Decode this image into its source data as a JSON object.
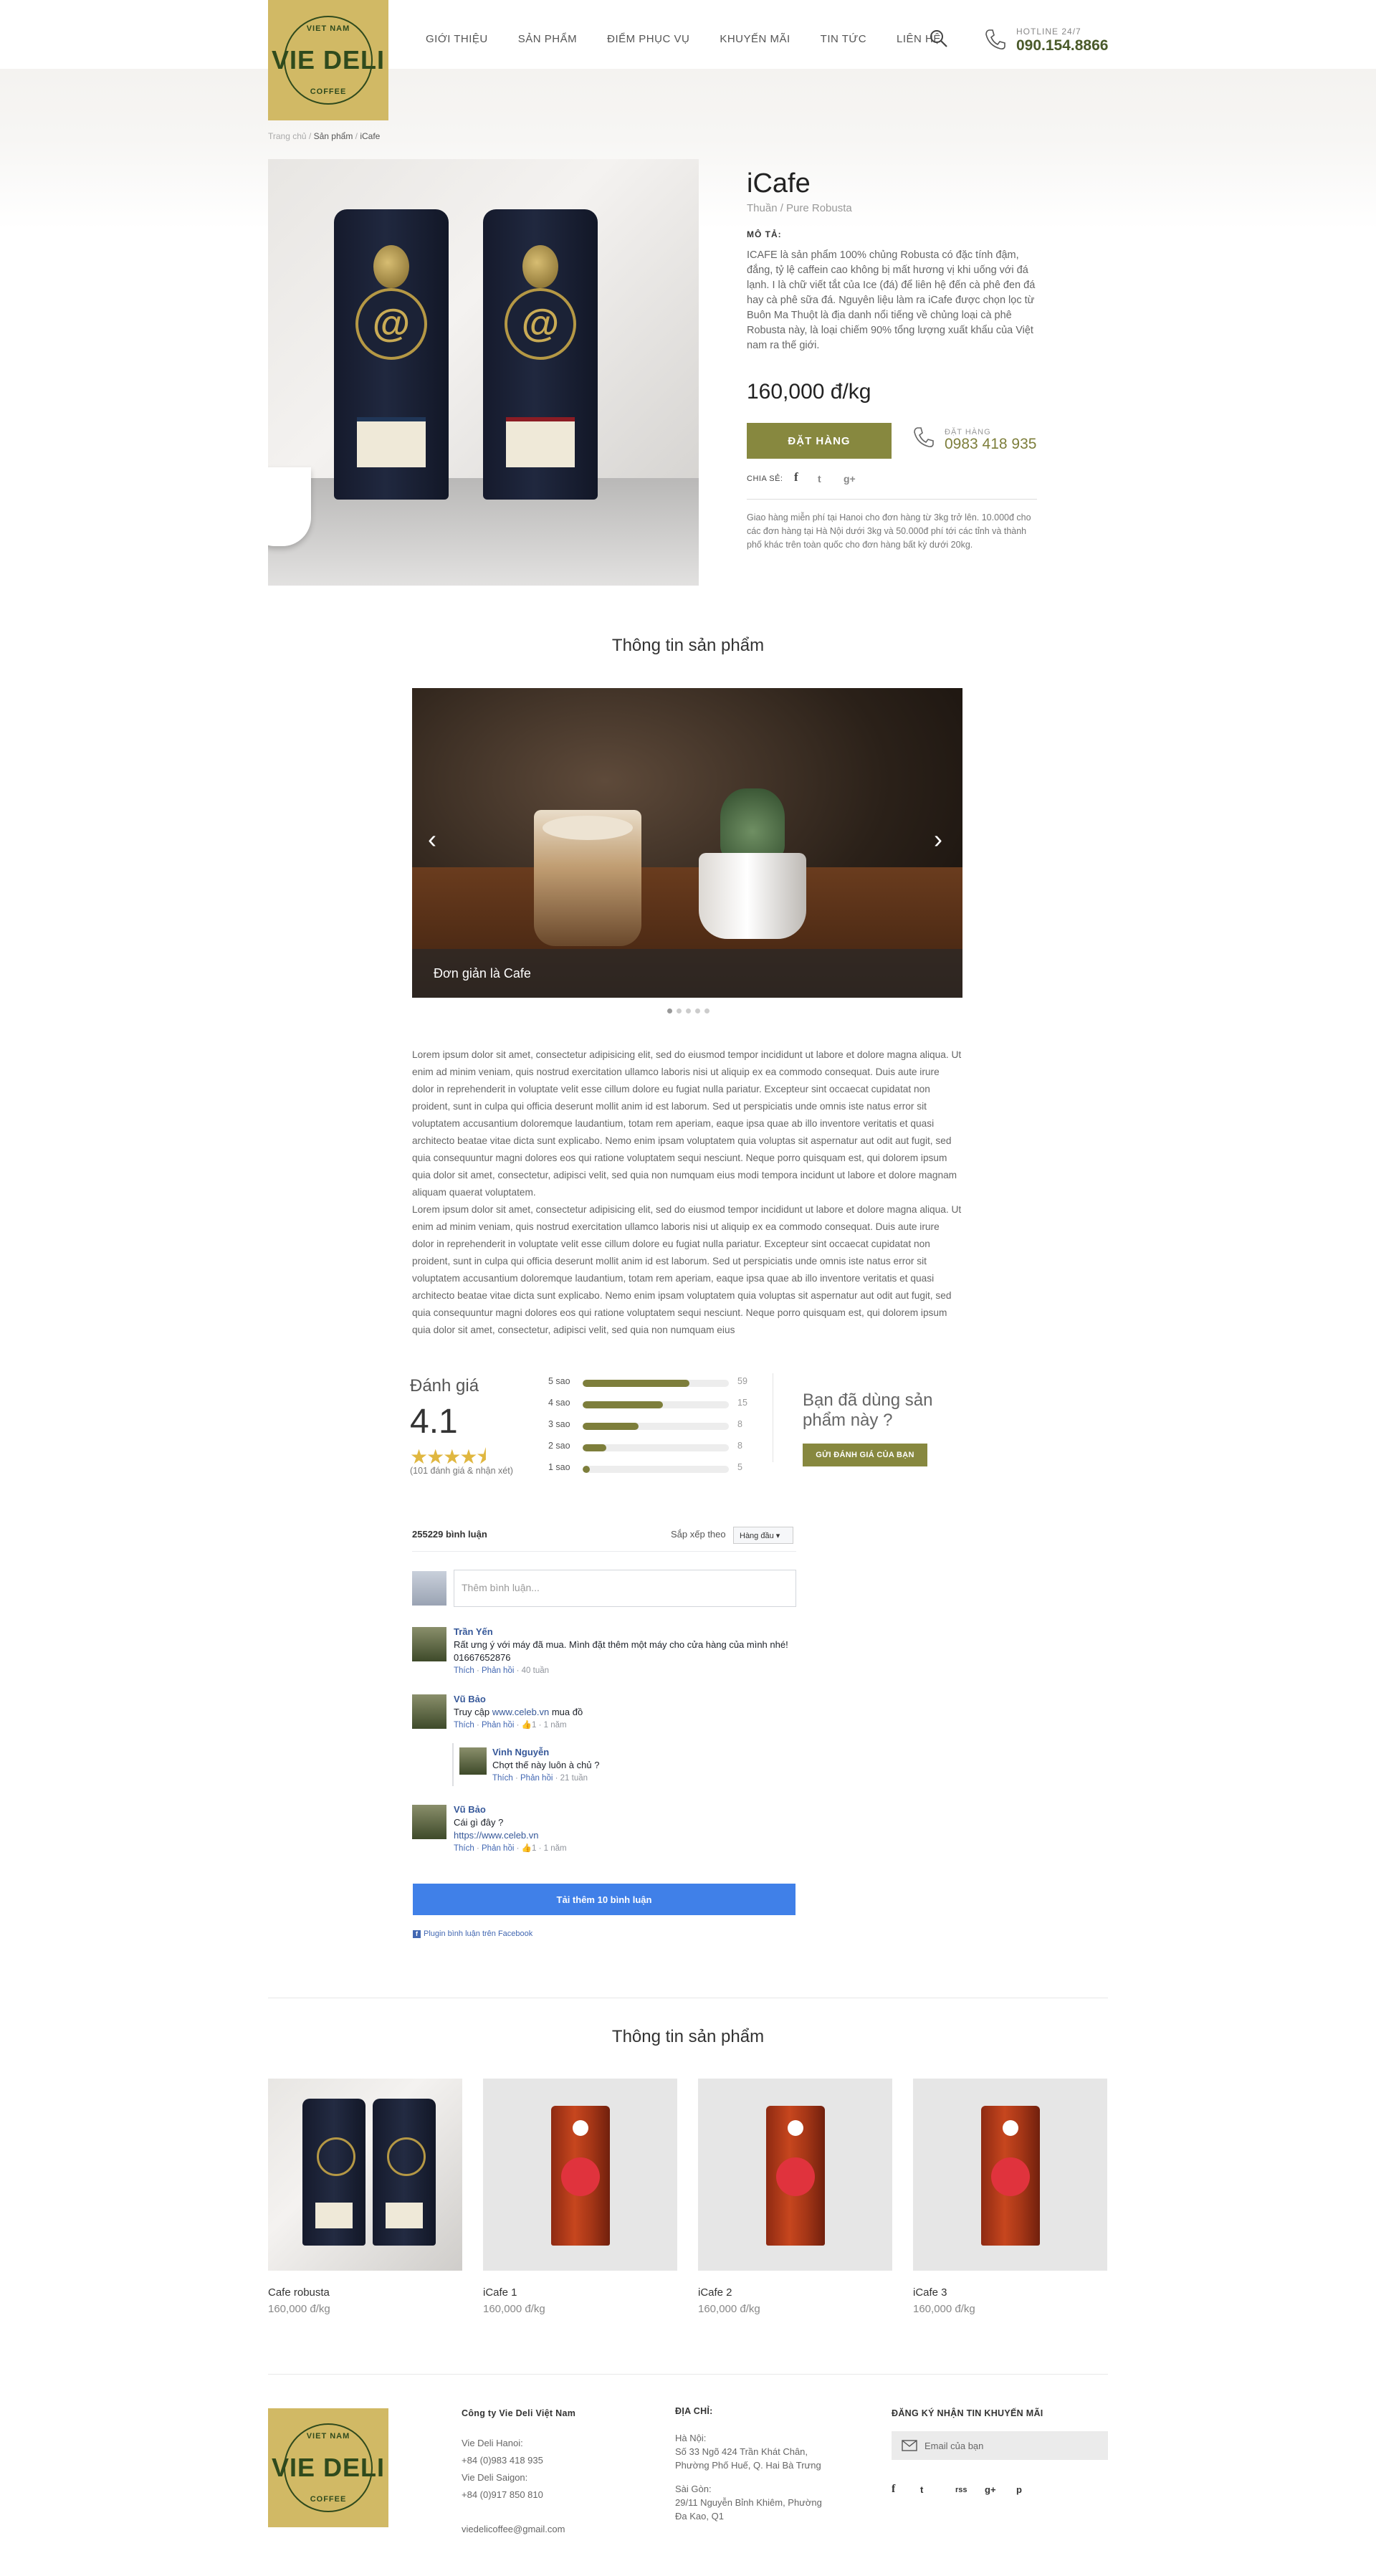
{
  "header": {
    "logo_top": "VIET NAM",
    "logo_main": "VIE DELI",
    "logo_bottom": "COFFEE",
    "nav": [
      "GIỚI THIỆU",
      "SẢN PHẨM",
      "ĐIỂM PHỤC VỤ",
      "KHUYẾN MÃI",
      "TIN TỨC",
      "LIÊN HỆ"
    ],
    "search_icon": "search-icon",
    "hotline_label": "HOTLINE 24/7",
    "hotline": "090.154.8866"
  },
  "breadcrumb": {
    "home": "Trang chủ",
    "sep1": " / ",
    "cat": "Sản phẩm",
    "sep2": " / ",
    "current": "iCafe"
  },
  "product": {
    "title": "iCafe",
    "subtitle": "Thuần / Pure Robusta",
    "desc_label": "MÔ TẢ:",
    "desc": "ICAFE là sản phẩm 100% chủng Robusta có đặc tính đậm, đắng, tỷ lệ caffein cao không bị mất hương vị khi uống với đá lạnh. I là chữ viết tắt của Ice (đá) để liên hệ đến cà phê đen đá hay cà phê sữa đá. Nguyên liệu làm ra iCafe được chọn lọc từ Buôn Ma Thuột là địa danh nổi tiếng về chủng loại cà phê Robusta này, là loại chiếm 90% tổng lượng xuất khẩu của Việt nam ra thế giới.",
    "price": "160,000 đ/kg",
    "order_button": "ĐẶT HÀNG",
    "order_label": "ĐẶT HÀNG",
    "order_phone": "0983 418 935",
    "share_label": "CHIA SẺ:",
    "share": [
      "f",
      "t",
      "g+"
    ],
    "shipping": "Giao hàng miễn phí tại Hanoi cho đơn hàng từ 3kg trở lên. 10.000đ cho các đơn hàng tại Hà Nội dưới 3kg và 50.000đ phí tới các tỉnh và thành phố khác trên toàn quốc cho đơn hàng bất kỳ dưới 20kg."
  },
  "info": {
    "title": "Thông tin sản phẩm",
    "slide_caption": "Đơn giản là Cafe",
    "slides": 5,
    "active_slide": 1,
    "para1": "Lorem ipsum dolor sit amet, consectetur adipisicing elit, sed do eiusmod tempor incididunt ut labore et dolore magna aliqua. Ut enim ad minim veniam, quis nostrud exercitation ullamco laboris nisi ut aliquip ex ea commodo consequat. Duis aute irure dolor in reprehenderit in voluptate velit esse cillum dolore eu fugiat nulla pariatur. Excepteur sint occaecat cupidatat non proident, sunt in culpa qui officia deserunt mollit anim id est laborum. Sed ut perspiciatis unde omnis iste natus error sit voluptatem accusantium doloremque laudantium, totam rem aperiam, eaque ipsa quae ab illo inventore veritatis et quasi architecto beatae vitae dicta sunt explicabo. Nemo enim ipsam voluptatem quia voluptas sit aspernatur aut odit aut fugit, sed quia consequuntur magni dolores eos qui ratione voluptatem sequi nesciunt. Neque porro quisquam est, qui dolorem ipsum quia dolor sit amet, consectetur, adipisci velit, sed quia non numquam eius modi tempora incidunt ut labore et dolore magnam aliquam quaerat voluptatem.",
    "para2": "Lorem ipsum dolor sit amet, consectetur adipisicing elit, sed do eiusmod tempor incididunt ut labore et dolore magna aliqua. Ut enim ad minim veniam, quis nostrud exercitation ullamco laboris nisi ut aliquip ex ea commodo consequat. Duis aute irure dolor in reprehenderit in voluptate velit esse cillum dolore eu fugiat nulla pariatur. Excepteur sint occaecat cupidatat non proident, sunt in culpa qui officia deserunt mollit anim id est laborum. Sed ut perspiciatis unde omnis iste natus error sit voluptatem accusantium doloremque laudantium, totam rem aperiam, eaque ipsa quae ab illo inventore veritatis et quasi architecto beatae vitae dicta sunt explicabo. Nemo enim ipsam voluptatem quia voluptas sit aspernatur aut odit aut fugit, sed quia consequuntur magni dolores eos qui ratione voluptatem sequi nesciunt. Neque porro quisquam est, qui dolorem ipsum quia dolor sit amet, consectetur, adipisci velit, sed quia non numquam eius"
  },
  "rating": {
    "label": "Đánh giá",
    "score": "4.1",
    "stars": 4.1,
    "count": "(101 đánh giá & nhận xét)",
    "bars": [
      {
        "label": "5 sao",
        "count": "59",
        "pct": 0.73
      },
      {
        "label": "4 sao",
        "count": "15",
        "pct": 0.55
      },
      {
        "label": "3 sao",
        "count": "8",
        "pct": 0.38
      },
      {
        "label": "2 sao",
        "count": "8",
        "pct": 0.16
      },
      {
        "label": "1 sao",
        "count": "5",
        "pct": 0.05
      }
    ],
    "question": "Bạn đã dùng sản phẩm này ?",
    "review_button": "GỬI ĐÁNH GIÁ CỦA BẠN"
  },
  "comments": {
    "count": "255229 bình luận",
    "sort_label": "Sắp xếp theo",
    "sort_value": "Hàng đầu ▾",
    "placeholder": "Thêm bình luận...",
    "items": [
      {
        "name": "Trần Yến",
        "text": "Rất ưng ý với máy đã mua. Mình đặt thêm một máy cho cửa hàng của mình nhé! 01667652876",
        "like": "Thích",
        "reply": "Phản hồi",
        "time": "40 tuần"
      },
      {
        "name": "Vũ Bảo",
        "text": "Truy cập",
        "link": "www.celeb.vn",
        "text2": "mua đồ",
        "like": "Thích",
        "reply": "Phản hồi",
        "likes": "1",
        "time": "1 năm"
      },
      {
        "name": "Vinh Nguyễn",
        "text": "Chợt thế này luôn à chủ ?",
        "like": "Thích",
        "reply": "Phản hồi",
        "time": "21 tuần"
      },
      {
        "name": "Vũ Bảo",
        "text": "Cái gì đây ?",
        "link": "https://www.celeb.vn",
        "like": "Thích",
        "reply": "Phản hồi",
        "likes": "1",
        "time": "1 năm"
      }
    ],
    "more_button": "Tải thêm 10 bình luận",
    "plugin": "Plugin bình luận trên Facebook"
  },
  "related": {
    "title": "Thông tin sản phẩm",
    "items": [
      {
        "name": "Cafe robusta",
        "price": "160,000 đ/kg"
      },
      {
        "name": "iCafe 1",
        "price": "160,000 đ/kg"
      },
      {
        "name": "iCafe 2",
        "price": "160,000 đ/kg"
      },
      {
        "name": "iCafe 3",
        "price": "160,000 đ/kg"
      }
    ]
  },
  "footer": {
    "company": "Công ty Vie Deli Việt Nam",
    "hanoi_name": "Vie Deli Hanoi:",
    "hanoi_phone": "+84 (0)983 418 935",
    "saigon_name": "Vie Deli Saigon:",
    "saigon_phone": "+84 (0)917 850 810",
    "email": "viedelicoffee@gmail.com",
    "address_label": "ĐỊA CHỈ:",
    "hn_label": "Hà Nội:",
    "hn_addr1": "Số 33 Ngõ 424 Trần Khát Chân,",
    "hn_addr2": "Phường Phố Huế, Q. Hai Bà Trưng",
    "sg_label": "Sài Gòn:",
    "sg_addr1": "29/11 Nguyễn Bỉnh Khiêm, Phường",
    "sg_addr2": "Đa Kao, Q1",
    "subscribe_label": "ĐĂNG KÝ NHẬN TIN KHUYẾN MÃI",
    "email_placeholder": "Email của bạn",
    "social": [
      "f",
      "t",
      "rss",
      "g+",
      "p"
    ]
  }
}
